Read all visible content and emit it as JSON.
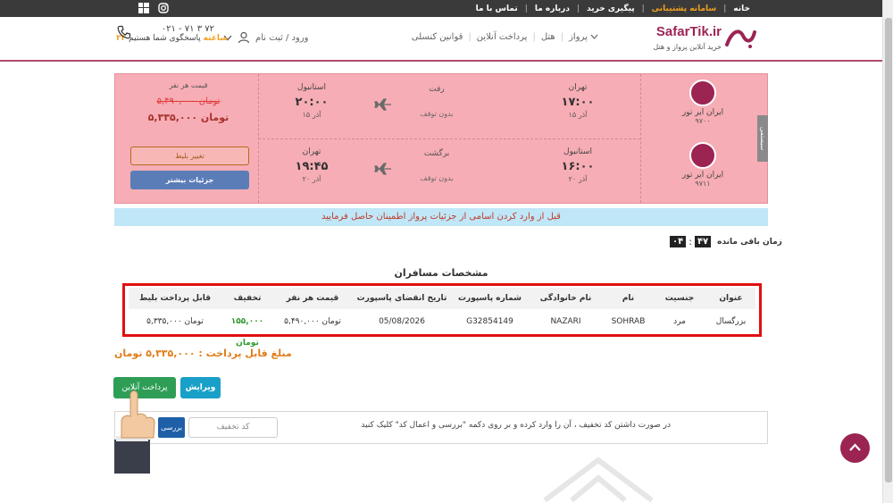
{
  "topbar": {
    "menu": [
      {
        "label": "خانه"
      },
      {
        "label": "سامانه پشتیبانی",
        "active": true
      },
      {
        "label": "پیگیری خرید"
      },
      {
        "label": "درباره ما"
      },
      {
        "label": "تماس با ما"
      }
    ],
    "social_icons": [
      "instagram-icon",
      "windows-icon"
    ]
  },
  "header": {
    "brand": "SafarTik.ir",
    "tagline": "خرید آنلاین پرواز و هتل",
    "nav": [
      "پرواز",
      "هتل",
      "پرداخت آنلاین",
      "قوانین کنسلی"
    ],
    "account": "ورود / ثبت نام",
    "phone": "۰۲۱ - ۷۱ ۳ ۷۲",
    "hours_bold": "۲۴ ساعته",
    "hours_rest": " پاسخگوی شما هستیم"
  },
  "flights": [
    {
      "airline": "ایران ایر تور",
      "flight_no": "۹۷۰۰",
      "from_city": "تهران",
      "from_time": "۱۷:۰۰",
      "from_date": "۱۵ آذر",
      "direction": "رفت",
      "stops": "بدون توقف",
      "to_city": "استانبول",
      "to_time": "۲۰:۰۰",
      "to_date": "۱۵ آذر"
    },
    {
      "airline": "ایران ایر تور",
      "flight_no": "۹۷۱۱",
      "from_city": "استانبول",
      "from_time": "۱۶:۰۰",
      "from_date": "۲۰ آذر",
      "direction": "برگشت",
      "stops": "بدون توقف",
      "to_city": "تهران",
      "to_time": "۱۹:۴۵",
      "to_date": "۲۰ آذر"
    }
  ],
  "price": {
    "label": "قیمت هر نفر",
    "old": "۵,۴۹۰,۰۰۰ تومان",
    "new": "۵,۳۳۵,۰۰۰ تومان",
    "change_button": "تغییر بلیط",
    "details_button": "جزئیات بیشتر",
    "side_tab": "سیستمی"
  },
  "notice": "قبل از وارد کردن اسامی از جزئیات پرواز اطمینان حاصل فرمایید",
  "timer": {
    "label": "زمان باقی مانده",
    "minutes": "۴۷",
    "seconds": "۰۴"
  },
  "passengers": {
    "title": "مشخصات مسافران",
    "headers": [
      "عنوان",
      "جنسیت",
      "نام",
      "نام خانوادگی",
      "شماره پاسپورت",
      "تاریخ انقضای پاسپورت",
      "قیمت هر نفر",
      "تخفیف",
      "قابل پرداخت بلیط"
    ],
    "rows": [
      [
        "بزرگسال",
        "مرد",
        "SOHRAB",
        "NAZARI",
        "G32854149",
        "05/08/2026",
        "۵,۴۹۰,۰۰۰ تومان",
        "۱۵۵,۰۰۰ تومان",
        "۵,۳۳۵,۰۰۰ تومان"
      ]
    ]
  },
  "total": "مبلغ قابل پرداخت : ۵,۳۳۵,۰۰۰ تومان",
  "actions": {
    "pay": "پرداخت آنلاین",
    "edit": "ویرایش"
  },
  "coupon": {
    "text": "در صورت داشتن کد تخفیف ، آن را وارد کرده و بر روی دکمه \"بررسی و اعمال کد\" کلیک کنید",
    "placeholder": "کد تخفیف",
    "check": "بررسی"
  },
  "colors": {
    "brand": "#9b2453",
    "card": "#f7adb5",
    "accent": "#f0a020",
    "pay": "#2e9e56",
    "edit": "#19a0c8",
    "highlight": "#e01010"
  }
}
